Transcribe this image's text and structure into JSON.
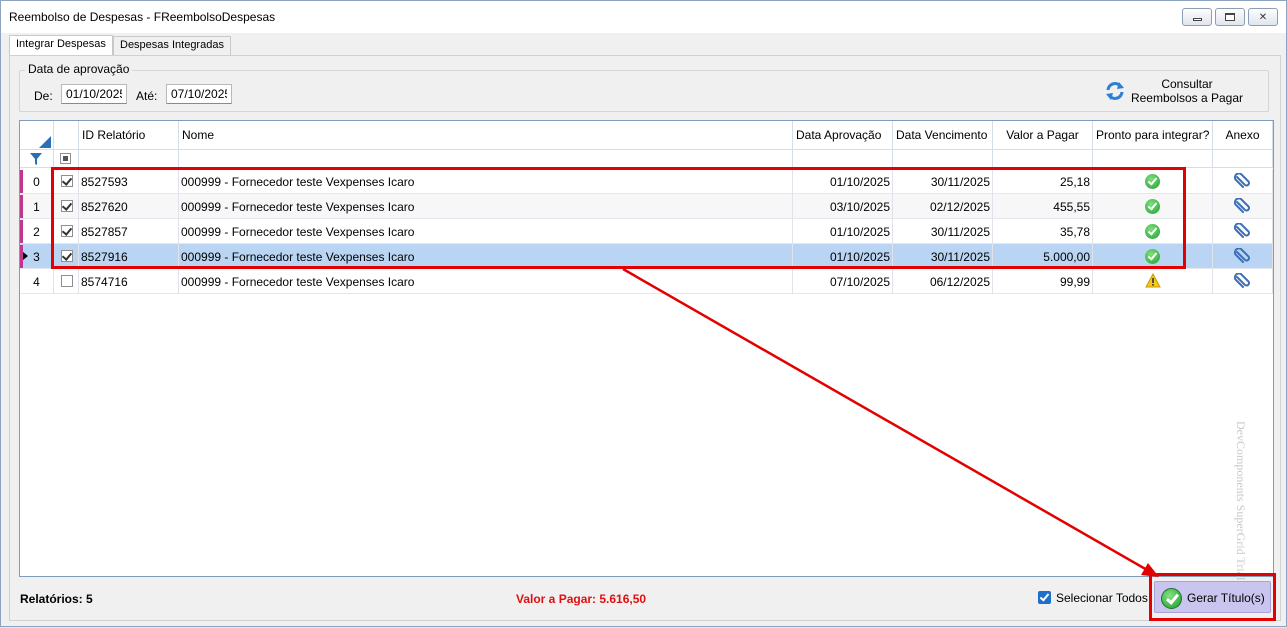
{
  "window": {
    "title": "Reembolso de Despesas - FReembolsoDespesas"
  },
  "tabs": [
    {
      "label": "Integrar Despesas",
      "active": true
    },
    {
      "label": "Despesas Integradas",
      "active": false
    }
  ],
  "filters": {
    "group_title": "Data de aprovação",
    "from_label": "De:",
    "from_value": "01/10/2025",
    "to_label": "Até:",
    "to_value": "07/10/2025",
    "consult_button": "Consultar Reembolsos a Pagar",
    "consult_icon": "refresh-icon"
  },
  "grid": {
    "columns": [
      "ID Relatório",
      "Nome",
      "Data Aprovação",
      "Data Vencimento",
      "Valor a Pagar",
      "Pronto para integrar?",
      "Anexo"
    ],
    "rows": [
      {
        "index": "0",
        "checked": true,
        "id": "8527593",
        "nome": "000999 - Fornecedor teste Vexpenses Icaro",
        "data_aprovacao": "01/10/2025",
        "data_vencimento": "30/11/2025",
        "valor": "25,18",
        "status": "ok"
      },
      {
        "index": "1",
        "checked": true,
        "id": "8527620",
        "nome": "000999 - Fornecedor teste Vexpenses Icaro",
        "data_aprovacao": "03/10/2025",
        "data_vencimento": "02/12/2025",
        "valor": "455,55",
        "status": "ok"
      },
      {
        "index": "2",
        "checked": true,
        "id": "8527857",
        "nome": "000999 - Fornecedor teste Vexpenses Icaro",
        "data_aprovacao": "01/10/2025",
        "data_vencimento": "30/11/2025",
        "valor": "35,78",
        "status": "ok"
      },
      {
        "index": "3",
        "checked": true,
        "id": "8527916",
        "nome": "000999 - Fornecedor teste Vexpenses Icaro",
        "data_aprovacao": "01/10/2025",
        "data_vencimento": "30/11/2025",
        "valor": "5.000,00",
        "status": "ok"
      },
      {
        "index": "4",
        "checked": false,
        "id": "8574716",
        "nome": "000999 - Fornecedor teste Vexpenses Icaro",
        "data_aprovacao": "07/10/2025",
        "data_vencimento": "06/12/2025",
        "valor": "99,99",
        "status": "warning"
      }
    ],
    "watermark": "DevComponents SuperGrid Trial"
  },
  "footer": {
    "relatorios": "Relatórios: 5",
    "valor_total": "Valor a Pagar: 5.616,50",
    "select_all_label": "Selecionar Todos",
    "select_all_checked": true,
    "gerar_button": "Gerar Título(s)"
  },
  "colors": {
    "annotation_red": "#e30000",
    "total_red": "#e01010",
    "selected_row": "#b9d5f3",
    "gerar_button_bg": "#c9c5ee"
  }
}
